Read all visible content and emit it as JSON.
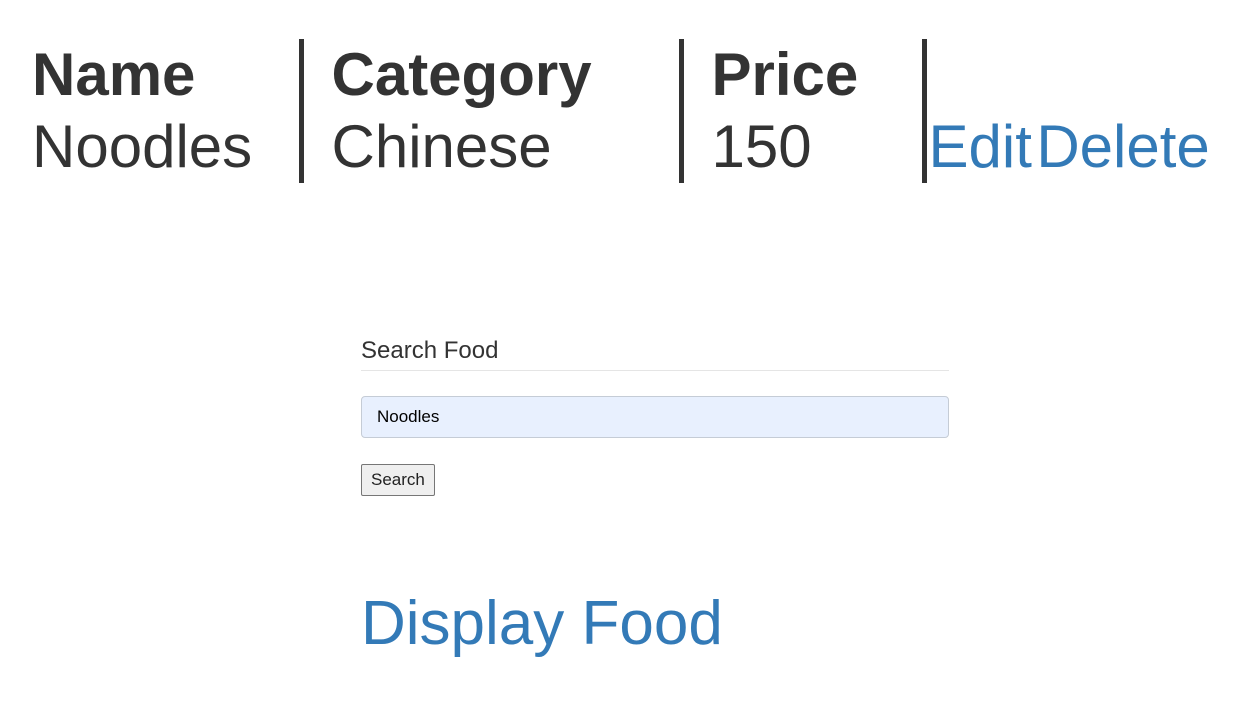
{
  "table": {
    "headers": {
      "name": "Name",
      "category": "Category",
      "price": "Price"
    },
    "rows": [
      {
        "name": "Noodles",
        "category": "Chinese",
        "price": "150",
        "edit_label": "Edit",
        "delete_label": "Delete"
      }
    ]
  },
  "search": {
    "legend": "Search Food",
    "input_value": "Noodles",
    "button_label": "Search"
  },
  "display_link": "Display Food",
  "colors": {
    "text": "#333333",
    "link": "#337ab7",
    "autofill_bg": "#e8f0fe"
  }
}
